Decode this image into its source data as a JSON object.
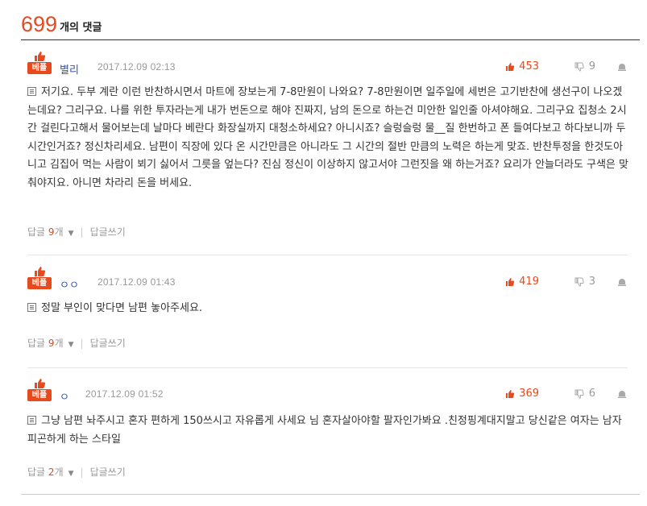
{
  "header": {
    "count": "699",
    "suffix": "개의 댓글"
  },
  "best_label": "베플",
  "reply_word": "답글",
  "reply_count_suffix": "개",
  "write_reply": "답글쓰기",
  "comments": [
    {
      "author": "별리",
      "date": "2017.12.09 02:13",
      "likes": "453",
      "dislikes": "9",
      "body": "저기요. 두부 계란 이런 반찬하시면서 마트에 장보는게 7-8만원이 나와요? 7-8만원이면 일주일에 세번은 고기반찬에 생선구이 나오겠는데요? 그리구요. 나를 위한 투자라는게 내가 번돈으로 해야 진짜지, 남의 돈으로 하는건 미안한 일인줄 아셔야해요. 그리구요 집청소 2시간 걸린다고해서 물어보는데 날마다 베란다 화장실까지 대청소하세요? 아니시죠? 슬렁슬렁 물__질 한번하고 폰 들여다보고 하다보니까 두시간인거죠? 정신차리세요. 남편이 직장에 있다 온 시간만큼은 아니라도 그 시간의 절반 만큼의 노력은 하는게 맞죠. 반찬투정을 한것도아니고 김집어 먹는 사람이 뵈기 싫어서 그릇을 엎는다? 진심 정신이 이상하지 않고서야 그런짓을 왜 하는거죠? 요리가 안늘더라도 구색은 맞춰야지요. 아니면 차라리 돈을 버세요.",
      "reply_count": "9"
    },
    {
      "author": "ㅇㅇ",
      "date": "2017.12.09 01:43",
      "likes": "419",
      "dislikes": "3",
      "body": "정말 부인이 맞다면 남편 놓아주세요.",
      "reply_count": "9"
    },
    {
      "author": "ㅇ",
      "date": "2017.12.09 01:52",
      "likes": "369",
      "dislikes": "6",
      "body": "그냥 남편 놔주시고 혼자 편하게 150쓰시고 자유롭게 사세요 님 혼자살아야할 팔자인가봐요 .친정핑계대지말고 당신같은 여자는 남자 피곤하게 하는 스타일",
      "reply_count": "2"
    }
  ],
  "colors": {
    "accent": "#e8491d",
    "author": "#3355aa",
    "muted": "#999999"
  }
}
